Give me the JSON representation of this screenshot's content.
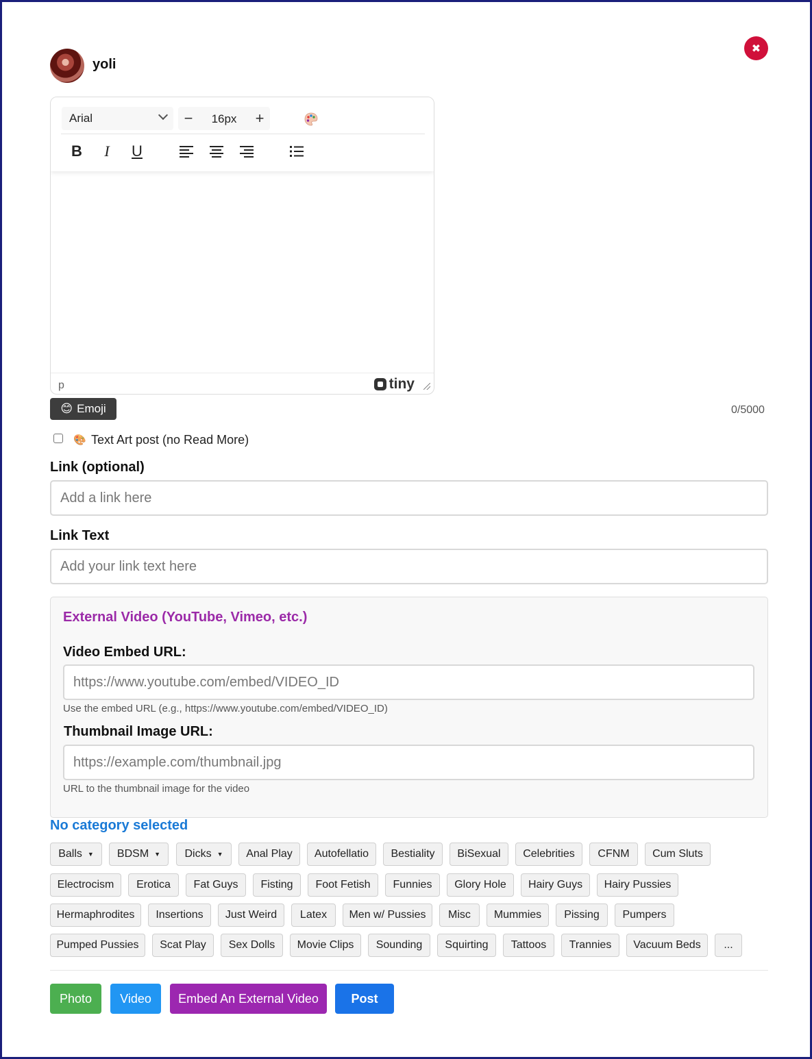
{
  "user": {
    "name": "yoli"
  },
  "close_glyph": "✖",
  "editor": {
    "font_family": "Arial",
    "font_size": "16px",
    "minus_glyph": "−",
    "plus_glyph": "+",
    "bold_glyph": "B",
    "italic_glyph": "I",
    "underline_glyph": "U",
    "status_path": "p",
    "brand": "tiny"
  },
  "emoji_button": {
    "icon": "😊",
    "label": "Emoji"
  },
  "char_counter": "0/5000",
  "text_art": {
    "icon": "🎨",
    "label": "Text Art post (no Read More)",
    "checked": false
  },
  "link": {
    "label": "Link (optional)",
    "placeholder": "Add a link here"
  },
  "link_text": {
    "label": "Link Text",
    "placeholder": "Add your link text here"
  },
  "external_video": {
    "title": "External Video (YouTube, Vimeo, etc.)",
    "embed_label": "Video Embed URL:",
    "embed_placeholder": "https://www.youtube.com/embed/VIDEO_ID",
    "embed_help": "Use the embed URL (e.g., https://www.youtube.com/embed/VIDEO_ID)",
    "thumb_label": "Thumbnail Image URL:",
    "thumb_placeholder": "https://example.com/thumbnail.jpg",
    "thumb_help": "URL to the thumbnail image for the video"
  },
  "category_status": "No category selected",
  "categories": [
    {
      "label": "Balls",
      "dropdown": true
    },
    {
      "label": "BDSM",
      "dropdown": true
    },
    {
      "label": "Dicks",
      "dropdown": true
    },
    {
      "label": "Anal Play"
    },
    {
      "label": "Autofellatio"
    },
    {
      "label": "Bestiality"
    },
    {
      "label": "BiSexual"
    },
    {
      "label": "Celebrities"
    },
    {
      "label": "CFNM"
    },
    {
      "label": "Cum Sluts"
    },
    {
      "label": "Electrocism"
    },
    {
      "label": "Erotica"
    },
    {
      "label": "Fat Guys"
    },
    {
      "label": "Fisting"
    },
    {
      "label": "Foot Fetish"
    },
    {
      "label": "Funnies"
    },
    {
      "label": "Glory Hole"
    },
    {
      "label": "Hairy Guys"
    },
    {
      "label": "Hairy Pussies"
    },
    {
      "label": "Hermaphrodites"
    },
    {
      "label": "Insertions"
    },
    {
      "label": "Just Weird"
    },
    {
      "label": "Latex"
    },
    {
      "label": "Men w/ Pussies"
    },
    {
      "label": "Misc"
    },
    {
      "label": "Mummies"
    },
    {
      "label": "Pissing"
    },
    {
      "label": "Pumpers"
    },
    {
      "label": "Pumped Pussies"
    },
    {
      "label": "Scat Play"
    },
    {
      "label": "Sex Dolls"
    },
    {
      "label": "Movie Clips"
    },
    {
      "label": "Sounding"
    },
    {
      "label": "Squirting"
    },
    {
      "label": "Tattoos"
    },
    {
      "label": "Trannies"
    },
    {
      "label": "Vacuum Beds"
    },
    {
      "label": "..."
    }
  ],
  "actions": {
    "photo": {
      "label": "Photo",
      "color": "#4caf50"
    },
    "video": {
      "label": "Video",
      "color": "#2196f3"
    },
    "embed": {
      "label": "Embed An External Video",
      "color": "#9c27b0"
    },
    "post": {
      "label": "Post",
      "color": "#1a73e8"
    }
  }
}
